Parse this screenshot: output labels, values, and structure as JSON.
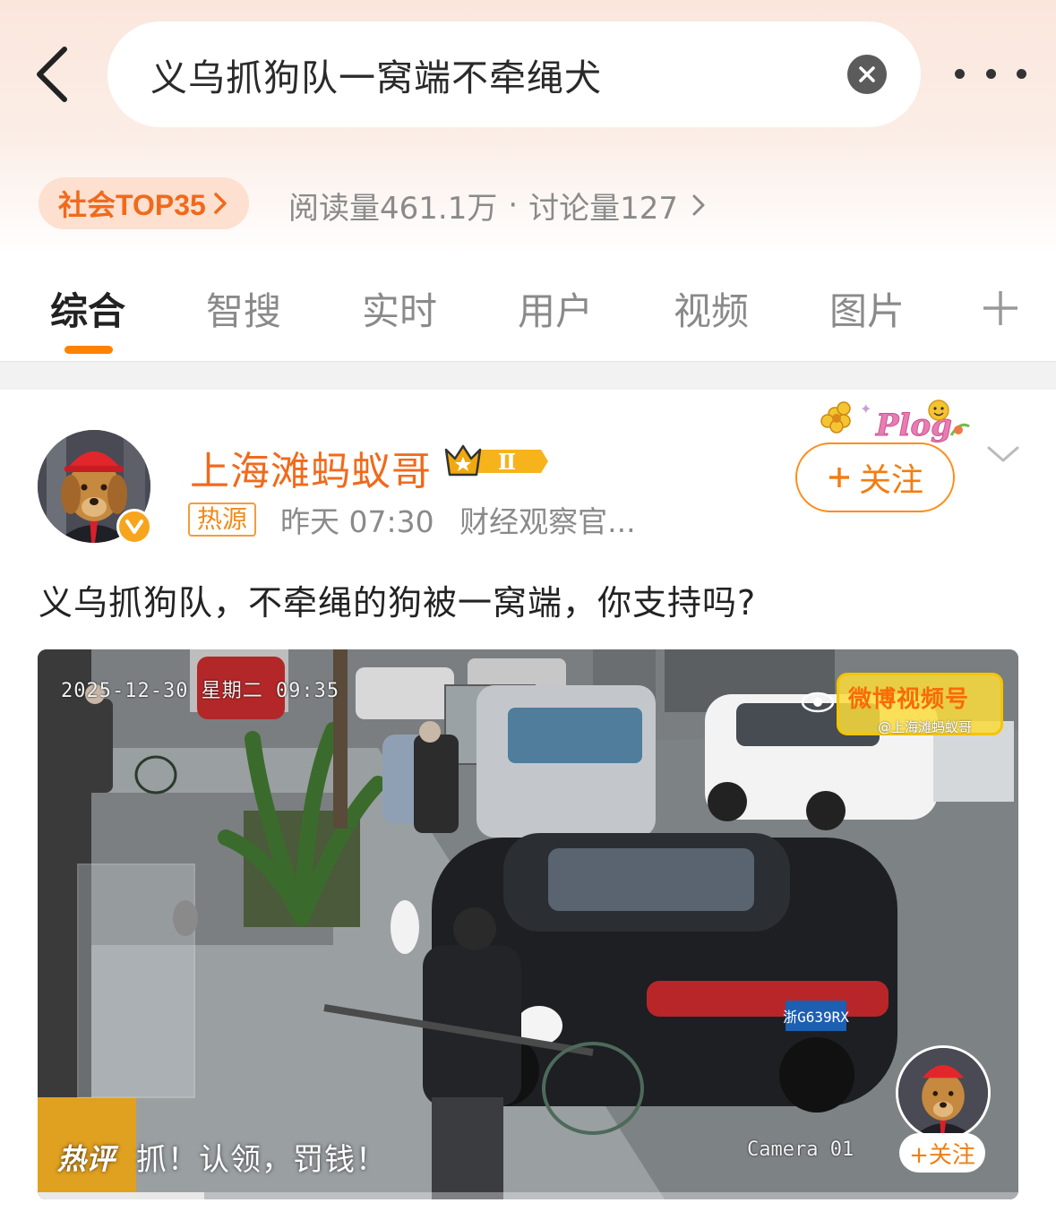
{
  "search": {
    "query": "义乌抓狗队一窝端不牵绳犬"
  },
  "topic": {
    "rank_label": "社会TOP35",
    "reads": "阅读量461.1万",
    "separator": "·",
    "discussions": "讨论量127"
  },
  "tabs": [
    {
      "label": "综合",
      "active": true
    },
    {
      "label": "智搜",
      "active": false
    },
    {
      "label": "实时",
      "active": false
    },
    {
      "label": "用户",
      "active": false
    },
    {
      "label": "视频",
      "active": false
    },
    {
      "label": "图片",
      "active": false
    }
  ],
  "post": {
    "author": "上海滩蚂蚁哥",
    "crown_level": "Ⅱ",
    "hot_tag": "热源",
    "time": "昨天 07:30",
    "source": "财经观察官...",
    "follow_label": "关注",
    "plog_label": "Plog",
    "text": "义乌抓狗队，不牵绳的狗被一窝端，你支持吗?"
  },
  "video": {
    "timestamp": "2025-12-30 星期二 09:35",
    "camera": "Camera 01",
    "plate": "浙G639RX",
    "watermark_title": "微博视频号",
    "watermark_sub": "@上海滩蚂蚁哥",
    "hot_label": "热评",
    "hot_comment": "抓！认领，罚钱！",
    "mini_follow": "+关注",
    "progress_fraction": 0.17
  },
  "colors": {
    "accent": "#ff8200",
    "author": "#f06a1c",
    "rank_bg": "#fde0cf"
  }
}
